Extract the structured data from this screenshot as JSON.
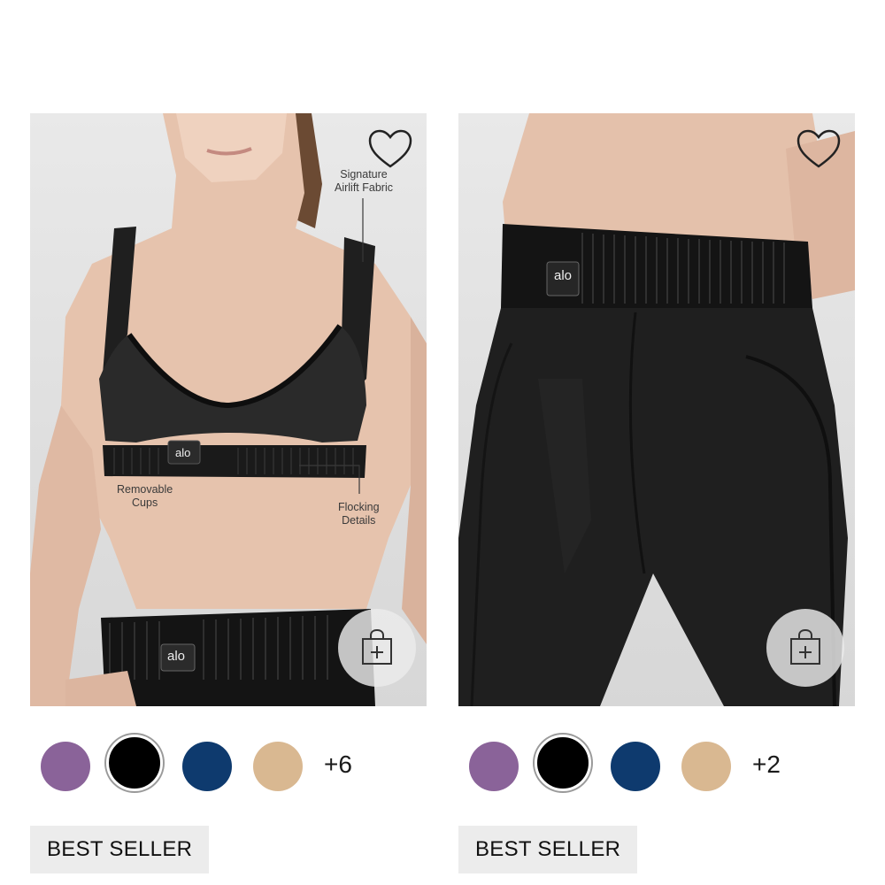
{
  "products": [
    {
      "image_alt": "",
      "callouts": {
        "signature": "Signature\nAirlift Fabric",
        "cups": "Removable\nCups",
        "flocking": "Flocking\nDetails"
      },
      "logo_text": "alo",
      "swatches": [
        {
          "color": "#8a6399",
          "name": "purple"
        },
        {
          "color": "#000000",
          "name": "black",
          "selected": true
        },
        {
          "color": "#0e3a6e",
          "name": "navy"
        },
        {
          "color": "#d9b891",
          "name": "tan"
        }
      ],
      "more_colors": "+6",
      "badge": "BEST SELLER"
    },
    {
      "logo_text": "alo",
      "swatches": [
        {
          "color": "#8a6399",
          "name": "purple"
        },
        {
          "color": "#000000",
          "name": "black",
          "selected": true
        },
        {
          "color": "#0e3a6e",
          "name": "navy"
        },
        {
          "color": "#d9b891",
          "name": "tan"
        }
      ],
      "more_colors": "+2",
      "badge": "BEST SELLER"
    }
  ],
  "icons": {
    "wishlist": "heart-icon",
    "quick_add": "shopping-bag-plus-icon"
  }
}
